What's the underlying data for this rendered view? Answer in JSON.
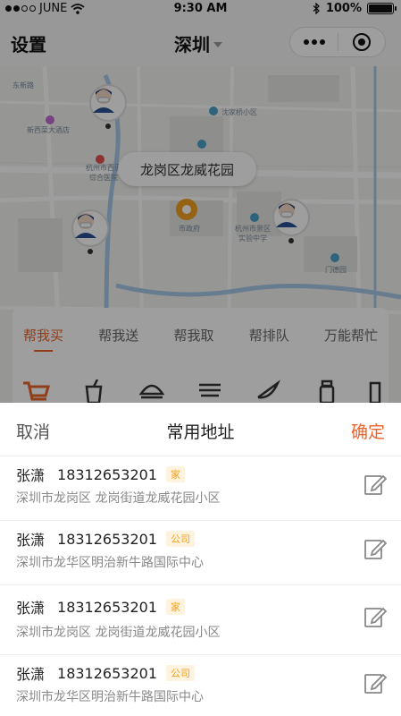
{
  "status_bar": {
    "carrier": "JUNE",
    "time": "9:30 AM",
    "battery": "100%",
    "battery_level": 1.0,
    "icons": [
      "signal-dots-icon",
      "wifi-icon",
      "bluetooth-icon",
      "battery-icon"
    ]
  },
  "nav": {
    "title": "设置",
    "city": "深圳",
    "icons": [
      "chevron-down-icon",
      "more-icon",
      "close-target-icon"
    ]
  },
  "map": {
    "location_bubble": "龙岗区龙威花园",
    "labels": {
      "hotel": "新西菜大酒店",
      "hospital": "杭州市西溪\n综合医院",
      "community": "沈家桥小区",
      "school": "杭州市景区\n实验中学",
      "park": "门德园",
      "road_left": "东新路",
      "poi_center": "市政府"
    }
  },
  "service": {
    "tabs": [
      "帮我买",
      "帮我送",
      "帮我取",
      "帮排队",
      "万能帮忙"
    ],
    "active_tab": 0,
    "icons": [
      "cart-icon",
      "drink-icon",
      "burger-icon",
      "noodles-icon",
      "watermelon-icon",
      "medicine-icon",
      "more-icon"
    ]
  },
  "sheet": {
    "cancel": "取消",
    "title": "常用地址",
    "confirm": "确定",
    "accent": "#e9632a"
  },
  "addresses": [
    {
      "name": "张潇",
      "phone": "18312653201",
      "tag": "家",
      "address": "深圳市龙岗区   龙岗街道龙威花园小区"
    },
    {
      "name": "张潇",
      "phone": "18312653201",
      "tag": "公司",
      "address": "深圳市龙华区明治新牛路国际中心"
    },
    {
      "name": "张潇",
      "phone": "18312653201",
      "tag": "家",
      "address": "深圳市龙岗区   龙岗街道龙威花园小区"
    },
    {
      "name": "张潇",
      "phone": "18312653201",
      "tag": "公司",
      "address": "深圳市龙华区明治新牛路国际中心"
    }
  ]
}
